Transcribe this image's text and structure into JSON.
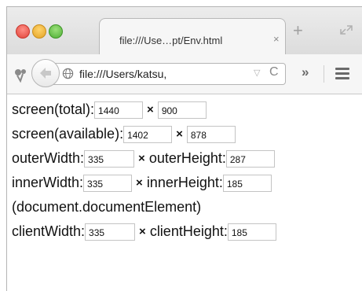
{
  "browser": {
    "tab_title": "file:///Use…pt/Env.html",
    "tab_close": "×",
    "new_tab": "+",
    "url": "file:///Users/katsu,",
    "reload_glyph": "C",
    "dropmark": "▽",
    "overflow": "»"
  },
  "rows": {
    "screen_total": {
      "label": "screen(total):",
      "times": "×",
      "width": "1440",
      "height": "900"
    },
    "screen_available": {
      "label": "screen(available):",
      "times": "×",
      "width": "1402",
      "height": "878"
    },
    "outer": {
      "width_label": "outerWidth:",
      "width": "335",
      "times": "×",
      "height_label": "outerHeight:",
      "height": "287"
    },
    "inner": {
      "width_label": "innerWidth:",
      "width": "335",
      "times": "×",
      "height_label": "innerHeight:",
      "height": "185"
    },
    "doc_note": "(document.documentElement)",
    "client": {
      "width_label": "clientWidth:",
      "width": "335",
      "times": "×",
      "height_label": "clientHeight:",
      "height": "185"
    }
  },
  "icons": [
    "back-arrow-icon",
    "globe-icon",
    "reload-icon",
    "menu-icon",
    "extension-icon",
    "fullscreen-icon"
  ]
}
